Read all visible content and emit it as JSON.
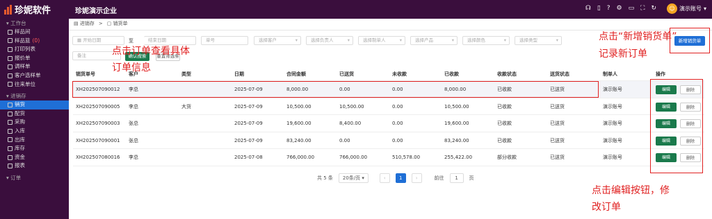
{
  "app": {
    "logo": "珍妮软件",
    "company": "珍妮演示企业",
    "account": "演示账号"
  },
  "sidebar": {
    "groups": [
      {
        "title": "工作台",
        "items": [
          {
            "label": "样品间"
          },
          {
            "label": "样品篮",
            "badge": "(0)"
          },
          {
            "label": "打印列表"
          },
          {
            "label": "报价单"
          },
          {
            "label": "调样单"
          },
          {
            "label": "客户选样单"
          },
          {
            "label": "往来单位"
          }
        ]
      },
      {
        "title": "进销存",
        "items": [
          {
            "label": "销货",
            "active": true
          },
          {
            "label": "配货"
          },
          {
            "label": "采购"
          },
          {
            "label": "入库"
          },
          {
            "label": "出库"
          },
          {
            "label": "库存"
          },
          {
            "label": "资金"
          },
          {
            "label": "报表"
          }
        ]
      },
      {
        "title": "订单",
        "items": []
      }
    ]
  },
  "breadcrumb": {
    "root": "进销存",
    "sep": ">",
    "current": "销货单"
  },
  "filters": {
    "start_date": "开始日期",
    "to": "至",
    "end_date": "结束日期",
    "order_no": "单号",
    "customer": "选择客户",
    "owner": "选择负责人",
    "creator": "选择制单人",
    "product": "选择产品",
    "color": "选择颜色",
    "type": "选择类型",
    "remark": "备注",
    "search": "确认搜索",
    "reset": "重置筛选条"
  },
  "new_button": "新增销货单",
  "table": {
    "headers": [
      "销货单号",
      "客户",
      "类型",
      "日期",
      "合同金额",
      "已送货",
      "未收款",
      "已收款",
      "收款状态",
      "送货状态",
      "制单人",
      "操作"
    ],
    "rows": [
      {
        "no": "XH202507090012",
        "customer": "李总",
        "type": "",
        "date": "2025-07-09",
        "contract": "8,000.00",
        "delivered": "0.00",
        "unpaid": "0.00",
        "paid": "8,000.00",
        "pay_status": "已收款",
        "ship_status": "已送货",
        "creator": "演示账号"
      },
      {
        "no": "XH202507090005",
        "customer": "李总",
        "type": "大货",
        "date": "2025-07-09",
        "contract": "10,500.00",
        "delivered": "10,500.00",
        "unpaid": "0.00",
        "paid": "10,500.00",
        "pay_status": "已收款",
        "ship_status": "已送货",
        "creator": "演示账号"
      },
      {
        "no": "XH202507090003",
        "customer": "张总",
        "type": "",
        "date": "2025-07-09",
        "contract": "19,600.00",
        "delivered": "8,400.00",
        "unpaid": "0.00",
        "paid": "19,600.00",
        "pay_status": "已收款",
        "ship_status": "已送货",
        "creator": "演示账号"
      },
      {
        "no": "XH202507090001",
        "customer": "张总",
        "type": "",
        "date": "2025-07-09",
        "contract": "83,240.00",
        "delivered": "0.00",
        "unpaid": "0.00",
        "paid": "83,240.00",
        "pay_status": "已收款",
        "ship_status": "已送货",
        "creator": "演示账号"
      },
      {
        "no": "XH202507080016",
        "customer": "李总",
        "type": "",
        "date": "2025-07-08",
        "contract": "766,000.00",
        "delivered": "766,000.00",
        "unpaid": "510,578.00",
        "paid": "255,422.00",
        "pay_status": "部分收款",
        "ship_status": "已送货",
        "creator": "演示账号"
      }
    ],
    "edit_label": "编辑",
    "delete_label": "删除"
  },
  "pager": {
    "total": "共 5 条",
    "page_size": "20条/页",
    "current": "1",
    "goto": "前往",
    "goto_value": "1",
    "page_unit": "页"
  },
  "annotations": {
    "new_order": "点击“新增销货单”",
    "new_order_2": "记录新订单",
    "view_order": "点击订单查看具体",
    "view_order_2": "订单信息",
    "edit_order": "点击编辑按钮，修",
    "edit_order_2": "改订单"
  },
  "colors": {
    "sidebar": "#3a0e3d",
    "accent": "#1f6fd6",
    "edit": "#1a7a4c",
    "annotation": "#e02020"
  }
}
